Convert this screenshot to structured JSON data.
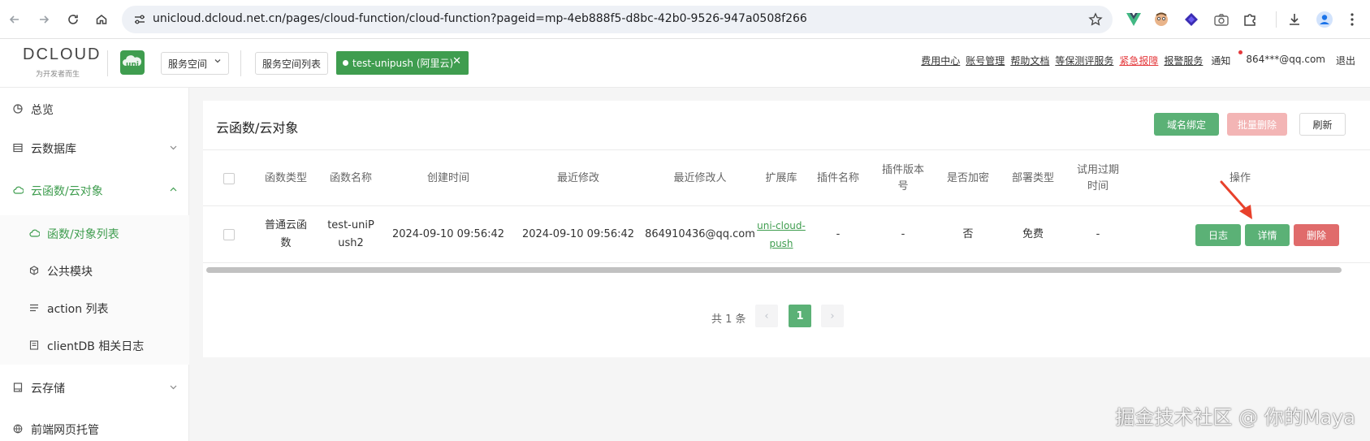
{
  "browser": {
    "url": "unicloud.dcloud.net.cn/pages/cloud-function/cloud-function?pageid=mp-4eb888f5-d8bc-42b0-9526-947a0508f266"
  },
  "header": {
    "logo_main": "DCLOUD",
    "logo_sub": "为开发者而生",
    "uni_logo": "uni",
    "space_select": "服务空间",
    "space_list_button": "服务空间列表",
    "env_tag": "test-unipush (阿里云)",
    "links": [
      "费用中心",
      "账号管理",
      "帮助文档",
      "等保测评服务",
      "紧急报障",
      "报警服务"
    ],
    "notice": "通知",
    "account": "864***@qq.com",
    "logout": "退出"
  },
  "sidebar": {
    "items": [
      {
        "label": "总览",
        "icon": "dashboard-icon"
      },
      {
        "label": "云数据库",
        "icon": "database-icon"
      },
      {
        "label": "云函数/云对象",
        "icon": "cloud-icon"
      },
      {
        "label": "云存储",
        "icon": "storage-icon"
      },
      {
        "label": "前端网页托管",
        "icon": "hosting-icon"
      }
    ],
    "subitems": [
      {
        "label": "函数/对象列表",
        "icon": "cloud-icon"
      },
      {
        "label": "公共模块",
        "icon": "cube-icon"
      },
      {
        "label": "action 列表",
        "icon": "list-icon"
      },
      {
        "label": "clientDB 相关日志",
        "icon": "log-icon"
      }
    ]
  },
  "main": {
    "title": "云函数/云对象",
    "buttons": {
      "bind_domain": "域名绑定",
      "batch_delete": "批量删除",
      "refresh": "刷新"
    },
    "columns": {
      "type": "函数类型",
      "name": "函数名称",
      "created": "创建时间",
      "modified": "最近修改",
      "modifier": "最近修改人",
      "ext": "扩展库",
      "plugin": "插件名称",
      "plugin_ver_1": "插件版本",
      "plugin_ver_2": "号",
      "encrypted": "是否加密",
      "deploy": "部署类型",
      "trial_1": "试用过期",
      "trial_2": "时间",
      "ops": "操作"
    },
    "row": {
      "type_1": "普通云函",
      "type_2": "数",
      "name_1": "test-uniP",
      "name_2": "ush2",
      "created": "2024-09-10 09:56:42",
      "modified": "2024-09-10 09:56:42",
      "modifier": "864910436@qq.com",
      "ext_1": "uni-cloud-",
      "ext_2": "push",
      "plugin": "-",
      "plugin_ver": "-",
      "encrypted": "否",
      "deploy": "免费",
      "trial": "-",
      "btn_log": "日志",
      "btn_detail": "详情",
      "btn_delete": "删除"
    },
    "pager": {
      "total": "共 1 条",
      "current": "1",
      "prev": "‹",
      "next": "›"
    }
  },
  "watermark": "掘金技术社区 @ 你的Maya",
  "colors": {
    "brand_green": "#3f9d4f",
    "button_green": "#5bb176",
    "danger": "#e06b6b",
    "arrow_red": "#e8412b"
  }
}
